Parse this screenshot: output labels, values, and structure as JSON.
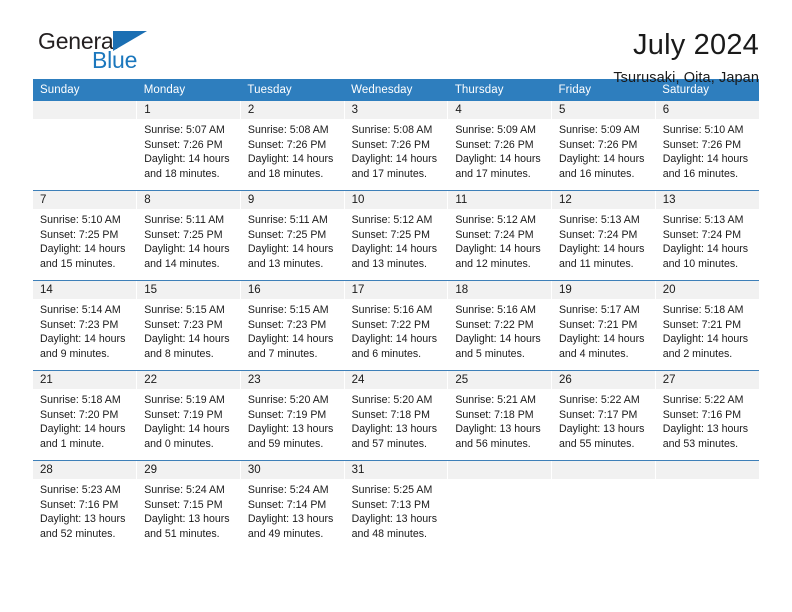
{
  "logo": {
    "word1": "General",
    "word2": "Blue"
  },
  "header": {
    "title": "July 2024",
    "subtitle": "Tsurusaki, Oita, Japan"
  },
  "calendar": {
    "weekdays": [
      "Sunday",
      "Monday",
      "Tuesday",
      "Wednesday",
      "Thursday",
      "Friday",
      "Saturday"
    ],
    "labels": {
      "sunrise": "Sunrise:",
      "sunset": "Sunset:",
      "daylight": "Daylight:"
    },
    "accent_color": "#2e7ebe",
    "daynum_bg": "#f1f1f1",
    "weeks": [
      [
        {
          "day": "",
          "empty": true
        },
        {
          "day": "1",
          "sunrise": "Sunrise: 5:07 AM",
          "sunset": "Sunset: 7:26 PM",
          "daylight": "Daylight: 14 hours and 18 minutes."
        },
        {
          "day": "2",
          "sunrise": "Sunrise: 5:08 AM",
          "sunset": "Sunset: 7:26 PM",
          "daylight": "Daylight: 14 hours and 18 minutes."
        },
        {
          "day": "3",
          "sunrise": "Sunrise: 5:08 AM",
          "sunset": "Sunset: 7:26 PM",
          "daylight": "Daylight: 14 hours and 17 minutes."
        },
        {
          "day": "4",
          "sunrise": "Sunrise: 5:09 AM",
          "sunset": "Sunset: 7:26 PM",
          "daylight": "Daylight: 14 hours and 17 minutes."
        },
        {
          "day": "5",
          "sunrise": "Sunrise: 5:09 AM",
          "sunset": "Sunset: 7:26 PM",
          "daylight": "Daylight: 14 hours and 16 minutes."
        },
        {
          "day": "6",
          "sunrise": "Sunrise: 5:10 AM",
          "sunset": "Sunset: 7:26 PM",
          "daylight": "Daylight: 14 hours and 16 minutes."
        }
      ],
      [
        {
          "day": "7",
          "sunrise": "Sunrise: 5:10 AM",
          "sunset": "Sunset: 7:25 PM",
          "daylight": "Daylight: 14 hours and 15 minutes."
        },
        {
          "day": "8",
          "sunrise": "Sunrise: 5:11 AM",
          "sunset": "Sunset: 7:25 PM",
          "daylight": "Daylight: 14 hours and 14 minutes."
        },
        {
          "day": "9",
          "sunrise": "Sunrise: 5:11 AM",
          "sunset": "Sunset: 7:25 PM",
          "daylight": "Daylight: 14 hours and 13 minutes."
        },
        {
          "day": "10",
          "sunrise": "Sunrise: 5:12 AM",
          "sunset": "Sunset: 7:25 PM",
          "daylight": "Daylight: 14 hours and 13 minutes."
        },
        {
          "day": "11",
          "sunrise": "Sunrise: 5:12 AM",
          "sunset": "Sunset: 7:24 PM",
          "daylight": "Daylight: 14 hours and 12 minutes."
        },
        {
          "day": "12",
          "sunrise": "Sunrise: 5:13 AM",
          "sunset": "Sunset: 7:24 PM",
          "daylight": "Daylight: 14 hours and 11 minutes."
        },
        {
          "day": "13",
          "sunrise": "Sunrise: 5:13 AM",
          "sunset": "Sunset: 7:24 PM",
          "daylight": "Daylight: 14 hours and 10 minutes."
        }
      ],
      [
        {
          "day": "14",
          "sunrise": "Sunrise: 5:14 AM",
          "sunset": "Sunset: 7:23 PM",
          "daylight": "Daylight: 14 hours and 9 minutes."
        },
        {
          "day": "15",
          "sunrise": "Sunrise: 5:15 AM",
          "sunset": "Sunset: 7:23 PM",
          "daylight": "Daylight: 14 hours and 8 minutes."
        },
        {
          "day": "16",
          "sunrise": "Sunrise: 5:15 AM",
          "sunset": "Sunset: 7:23 PM",
          "daylight": "Daylight: 14 hours and 7 minutes."
        },
        {
          "day": "17",
          "sunrise": "Sunrise: 5:16 AM",
          "sunset": "Sunset: 7:22 PM",
          "daylight": "Daylight: 14 hours and 6 minutes."
        },
        {
          "day": "18",
          "sunrise": "Sunrise: 5:16 AM",
          "sunset": "Sunset: 7:22 PM",
          "daylight": "Daylight: 14 hours and 5 minutes."
        },
        {
          "day": "19",
          "sunrise": "Sunrise: 5:17 AM",
          "sunset": "Sunset: 7:21 PM",
          "daylight": "Daylight: 14 hours and 4 minutes."
        },
        {
          "day": "20",
          "sunrise": "Sunrise: 5:18 AM",
          "sunset": "Sunset: 7:21 PM",
          "daylight": "Daylight: 14 hours and 2 minutes."
        }
      ],
      [
        {
          "day": "21",
          "sunrise": "Sunrise: 5:18 AM",
          "sunset": "Sunset: 7:20 PM",
          "daylight": "Daylight: 14 hours and 1 minute."
        },
        {
          "day": "22",
          "sunrise": "Sunrise: 5:19 AM",
          "sunset": "Sunset: 7:19 PM",
          "daylight": "Daylight: 14 hours and 0 minutes."
        },
        {
          "day": "23",
          "sunrise": "Sunrise: 5:20 AM",
          "sunset": "Sunset: 7:19 PM",
          "daylight": "Daylight: 13 hours and 59 minutes."
        },
        {
          "day": "24",
          "sunrise": "Sunrise: 5:20 AM",
          "sunset": "Sunset: 7:18 PM",
          "daylight": "Daylight: 13 hours and 57 minutes."
        },
        {
          "day": "25",
          "sunrise": "Sunrise: 5:21 AM",
          "sunset": "Sunset: 7:18 PM",
          "daylight": "Daylight: 13 hours and 56 minutes."
        },
        {
          "day": "26",
          "sunrise": "Sunrise: 5:22 AM",
          "sunset": "Sunset: 7:17 PM",
          "daylight": "Daylight: 13 hours and 55 minutes."
        },
        {
          "day": "27",
          "sunrise": "Sunrise: 5:22 AM",
          "sunset": "Sunset: 7:16 PM",
          "daylight": "Daylight: 13 hours and 53 minutes."
        }
      ],
      [
        {
          "day": "28",
          "sunrise": "Sunrise: 5:23 AM",
          "sunset": "Sunset: 7:16 PM",
          "daylight": "Daylight: 13 hours and 52 minutes."
        },
        {
          "day": "29",
          "sunrise": "Sunrise: 5:24 AM",
          "sunset": "Sunset: 7:15 PM",
          "daylight": "Daylight: 13 hours and 51 minutes."
        },
        {
          "day": "30",
          "sunrise": "Sunrise: 5:24 AM",
          "sunset": "Sunset: 7:14 PM",
          "daylight": "Daylight: 13 hours and 49 minutes."
        },
        {
          "day": "31",
          "sunrise": "Sunrise: 5:25 AM",
          "sunset": "Sunset: 7:13 PM",
          "daylight": "Daylight: 13 hours and 48 minutes."
        },
        {
          "day": "",
          "empty": true
        },
        {
          "day": "",
          "empty": true
        },
        {
          "day": "",
          "empty": true
        }
      ]
    ]
  }
}
